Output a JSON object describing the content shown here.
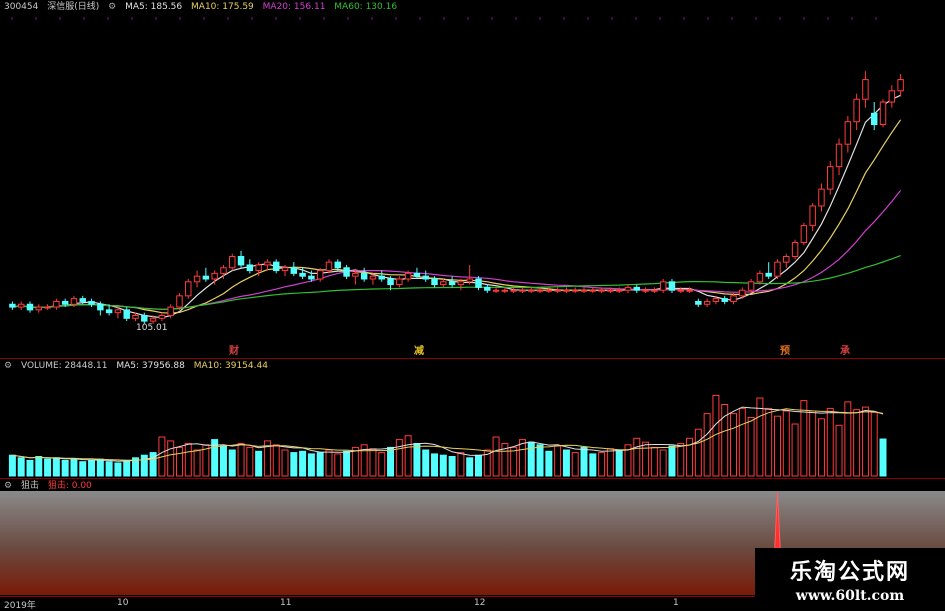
{
  "price_legend": {
    "symbol": "300454",
    "name": "深信服(日线)",
    "icon": "gear-icon",
    "ma5": "MA5: 185.56",
    "ma10": "MA10: 175.59",
    "ma20": "MA20: 156.11",
    "ma60": "MA60: 130.16"
  },
  "volume_legend": {
    "label": "VOLUME: 28448.11",
    "ma5": "MA5: 37956.88",
    "ma10": "MA10: 39154.44"
  },
  "indicator_legend": {
    "name": "狙击",
    "value_label": "狙击: 0.00"
  },
  "low_price_label": "105.01",
  "events": [
    {
      "label": "财",
      "color": "#d04040"
    },
    {
      "label": "减",
      "color": "#e0c020"
    },
    {
      "label": "预",
      "color": "#e07020"
    },
    {
      "label": "承",
      "color": "#d04040"
    }
  ],
  "date_axis": {
    "year_label": "2019年",
    "ticks": [
      "10",
      "11",
      "12",
      "1"
    ]
  },
  "watermark": {
    "title": "乐淘公式网",
    "url": "www.60lt.com"
  },
  "colors": {
    "up": "#ff3b3b",
    "down": "#54ffff",
    "ma5": "#e0e0e0",
    "ma10": "#e8d060",
    "ma20": "#d040d0",
    "ma60": "#30c030",
    "grid": "#8b0000"
  },
  "chart_data": [
    {
      "type": "candlestick",
      "title": "300454 深信服(日线)",
      "ylabel": "",
      "ylim": [
        95,
        215
      ],
      "annotation_low": 105.01,
      "ohlc": [
        [
          112,
          113,
          110,
          111
        ],
        [
          111,
          113,
          110,
          112
        ],
        [
          112,
          113,
          109,
          110
        ],
        [
          110,
          112,
          109,
          111
        ],
        [
          111,
          112,
          110,
          111
        ],
        [
          111,
          114,
          110,
          113
        ],
        [
          113,
          114,
          111,
          112
        ],
        [
          112,
          115,
          111,
          114
        ],
        [
          114,
          115,
          112,
          113
        ],
        [
          113,
          114,
          111,
          112
        ],
        [
          112,
          113,
          108,
          110
        ],
        [
          110,
          112,
          108,
          109
        ],
        [
          109,
          111,
          107,
          110
        ],
        [
          110,
          111,
          106,
          107
        ],
        [
          107,
          109,
          106,
          108
        ],
        [
          108,
          109,
          105,
          106
        ],
        [
          106,
          108,
          105.01,
          107
        ],
        [
          107,
          109,
          106,
          108
        ],
        [
          108,
          112,
          107,
          111
        ],
        [
          111,
          116,
          110,
          115
        ],
        [
          115,
          121,
          114,
          120
        ],
        [
          120,
          124,
          118,
          122
        ],
        [
          122,
          125,
          120,
          121
        ],
        [
          121,
          124,
          119,
          123
        ],
        [
          123,
          126,
          121,
          125
        ],
        [
          125,
          130,
          124,
          129
        ],
        [
          129,
          131,
          125,
          126
        ],
        [
          126,
          128,
          123,
          124
        ],
        [
          124,
          127,
          122,
          126
        ],
        [
          126,
          128,
          124,
          127
        ],
        [
          127,
          128,
          123,
          124
        ],
        [
          124,
          126,
          122,
          125
        ],
        [
          125,
          127,
          122,
          123
        ],
        [
          123,
          125,
          121,
          122
        ],
        [
          122,
          124,
          120,
          121
        ],
        [
          121,
          125,
          120,
          124
        ],
        [
          124,
          128,
          123,
          127
        ],
        [
          127,
          128,
          124,
          125
        ],
        [
          125,
          126,
          121,
          122
        ],
        [
          122,
          124,
          119,
          123
        ],
        [
          123,
          125,
          120,
          121
        ],
        [
          121,
          123,
          119,
          122
        ],
        [
          122,
          124,
          120,
          121
        ],
        [
          121,
          122,
          117,
          119
        ],
        [
          119,
          122,
          118,
          121
        ],
        [
          121,
          124,
          120,
          123
        ],
        [
          123,
          125,
          121,
          122
        ],
        [
          122,
          124,
          120,
          121
        ],
        [
          121,
          122,
          118,
          119
        ],
        [
          119,
          121,
          118,
          120
        ],
        [
          120,
          122,
          118,
          119
        ],
        [
          119,
          121,
          117,
          120
        ],
        [
          120,
          126,
          119,
          121
        ],
        [
          121,
          122,
          117,
          118
        ],
        [
          118,
          119,
          116,
          117
        ],
        [
          117,
          118,
          116,
          117
        ],
        [
          117,
          118,
          116,
          117
        ],
        [
          117,
          118,
          116,
          117
        ],
        [
          117,
          118,
          116,
          117
        ],
        [
          117,
          118,
          116,
          117
        ],
        [
          117,
          118,
          116,
          117
        ],
        [
          117,
          118,
          116,
          117
        ],
        [
          117,
          118,
          116,
          117
        ],
        [
          117,
          118,
          116,
          117
        ],
        [
          117,
          118,
          116,
          117
        ],
        [
          117,
          118,
          116,
          117
        ],
        [
          117,
          118,
          116,
          117
        ],
        [
          117,
          118,
          116,
          117
        ],
        [
          117,
          118,
          116,
          117
        ],
        [
          117,
          118,
          116,
          117
        ],
        [
          117,
          119,
          116,
          118
        ],
        [
          118,
          119,
          116,
          117
        ],
        [
          117,
          118,
          116,
          117
        ],
        [
          117,
          118,
          116,
          117
        ],
        [
          117,
          121,
          116,
          120
        ],
        [
          120,
          121,
          116,
          117
        ],
        [
          117,
          118,
          116,
          117
        ],
        [
          117,
          118,
          116,
          117
        ],
        [
          113,
          114,
          111,
          112
        ],
        [
          112,
          114,
          111,
          113
        ],
        [
          113,
          115,
          112,
          114
        ],
        [
          114,
          115,
          112,
          113
        ],
        [
          113,
          116,
          112,
          115
        ],
        [
          115,
          118,
          114,
          117
        ],
        [
          117,
          121,
          116,
          120
        ],
        [
          120,
          124,
          119,
          123
        ],
        [
          123,
          127,
          121,
          122
        ],
        [
          122,
          128,
          121,
          127
        ],
        [
          127,
          130,
          125,
          129
        ],
        [
          129,
          135,
          128,
          134
        ],
        [
          134,
          141,
          133,
          140
        ],
        [
          140,
          148,
          138,
          147
        ],
        [
          147,
          155,
          145,
          153
        ],
        [
          153,
          163,
          151,
          161
        ],
        [
          161,
          171,
          158,
          169
        ],
        [
          169,
          179,
          166,
          177
        ],
        [
          177,
          187,
          174,
          185
        ],
        [
          185,
          195,
          182,
          192
        ],
        [
          180,
          184,
          174,
          176
        ],
        [
          176,
          185,
          175,
          184
        ],
        [
          184,
          190,
          182,
          188
        ],
        [
          188,
          194,
          186,
          192
        ]
      ],
      "ma_series": [
        {
          "name": "MA5",
          "last": 185.56
        },
        {
          "name": "MA10",
          "last": 175.59
        },
        {
          "name": "MA20",
          "last": 156.11
        },
        {
          "name": "MA60",
          "last": 130.16
        }
      ]
    },
    {
      "type": "bar",
      "title": "VOLUME",
      "ylim": [
        0,
        80000
      ],
      "values": [
        16000,
        14000,
        12000,
        15000,
        13000,
        14000,
        12000,
        13000,
        11000,
        12000,
        13000,
        11000,
        10000,
        12000,
        14000,
        16000,
        18000,
        30000,
        27000,
        22000,
        25000,
        20000,
        24000,
        28000,
        23000,
        20000,
        25000,
        22000,
        19000,
        27000,
        24000,
        20000,
        18000,
        19000,
        17000,
        18000,
        20000,
        17000,
        19000,
        22000,
        24000,
        21000,
        18000,
        22000,
        28000,
        31000,
        25000,
        20000,
        17000,
        16000,
        15000,
        18000,
        14000,
        16000,
        20000,
        30000,
        25000,
        22000,
        28000,
        26000,
        24000,
        19000,
        23000,
        20000,
        18000,
        22000,
        17000,
        18000,
        21000,
        20000,
        24000,
        29000,
        26000,
        22000,
        20000,
        23000,
        25000,
        29000,
        36000,
        48000,
        62000,
        55000,
        48000,
        52000,
        45000,
        60000,
        52000,
        46000,
        50000,
        40000,
        58000,
        50000,
        44000,
        52000,
        39000,
        57000,
        51000,
        53000,
        49000,
        28448
      ],
      "up_flags": [
        0,
        0,
        0,
        0,
        0,
        0,
        0,
        0,
        0,
        0,
        0,
        0,
        0,
        0,
        0,
        0,
        0,
        1,
        1,
        1,
        1,
        1,
        1,
        0,
        0,
        0,
        1,
        1,
        0,
        1,
        1,
        1,
        0,
        0,
        0,
        0,
        1,
        1,
        0,
        1,
        1,
        1,
        1,
        0,
        1,
        1,
        0,
        0,
        0,
        0,
        0,
        1,
        0,
        0,
        1,
        1,
        1,
        1,
        1,
        0,
        0,
        0,
        1,
        0,
        1,
        0,
        0,
        1,
        1,
        0,
        1,
        1,
        1,
        1,
        1,
        0,
        1,
        1,
        1,
        1,
        1,
        1,
        1,
        1,
        1,
        1,
        1,
        1,
        1,
        1,
        1,
        1,
        1,
        1,
        1,
        1,
        1,
        1,
        1,
        0
      ],
      "ma_series": [
        {
          "name": "MA5",
          "last": 37956.88
        },
        {
          "name": "MA10",
          "last": 39154.44
        }
      ]
    },
    {
      "type": "line",
      "title": "狙击",
      "values_note": "signal spike near index 87",
      "last": 0.0
    }
  ]
}
